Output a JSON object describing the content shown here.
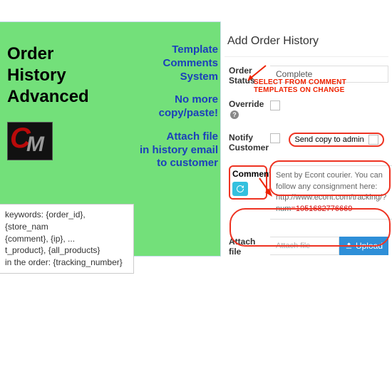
{
  "promo": {
    "title_l1": "Order",
    "title_l2": "History",
    "title_l3": "Advanced",
    "feat1_l1": "Template",
    "feat1_l2": "Comments",
    "feat1_l3": "System",
    "feat2_l1": "No more",
    "feat2_l2": "copy/paste!",
    "feat3_l1": "Attach file",
    "feat3_l2": "in history email",
    "feat3_l3": "to customer",
    "logo_c": "C",
    "logo_m": "M",
    "keywords_l1": "keywords: {order_id}, {store_nam",
    "keywords_l2": "{comment}, {ip}, ...",
    "keywords_l3": "t_product}, {all_products}",
    "keywords_l4": "in the order: {tracking_number}"
  },
  "form": {
    "heading": "Add Order History",
    "status_label": "Order Status",
    "status_value": "Complete",
    "override_label": "Override",
    "notify_label_l1": "Notify",
    "notify_label_l2": "Customer",
    "send_copy_label": "Send copy to admin",
    "comment_label": "Comment",
    "comment_text_pre": "Sent by Econt courier. You can follow any consignment here: http://www.econt.com/tracking/?num",
    "comment_tracking": "=1051682776669",
    "attach_label_l1": "Attach",
    "attach_label_l2": "file",
    "attach_placeholder": "Attach file",
    "upload_label": "Upload"
  },
  "annotation": {
    "select_from": "SELECT FROM COMMENT TEMPLATES ON CHANGE"
  }
}
